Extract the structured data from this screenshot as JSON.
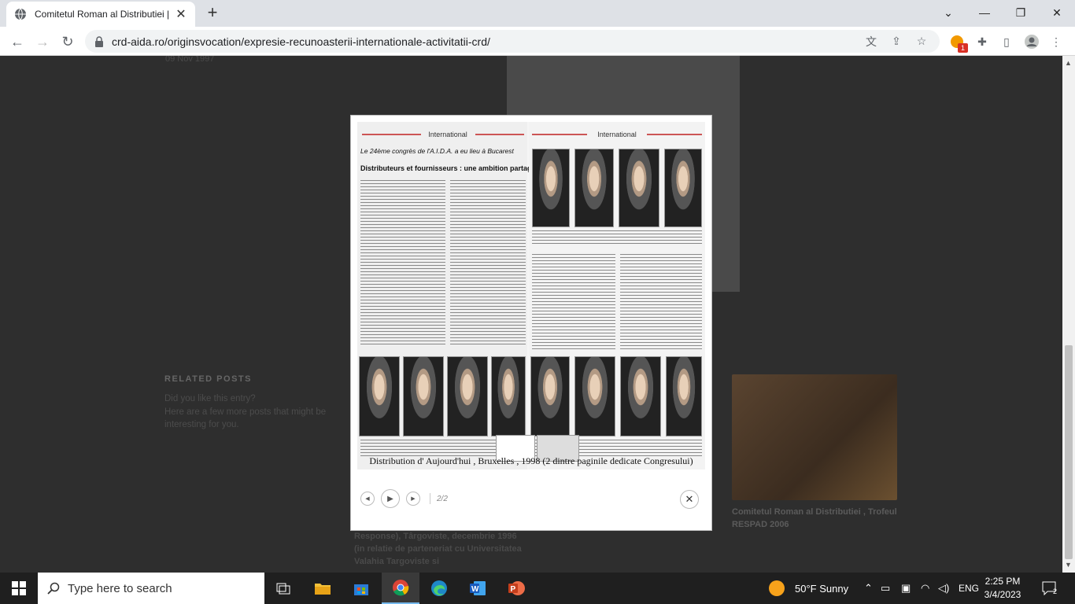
{
  "browser": {
    "tab_title": "Comitetul Roman al Distributiei |",
    "url": "crd-aida.ro/originsvocation/expresie-recunoasterii-internationale-activitatii-crd/",
    "extension_badge": "1"
  },
  "page": {
    "date_text": "09 Nov 1997",
    "related_title": "RELATED POSTS",
    "related_desc": "Did you like this entry?\nHere are a few more posts that might be interesting for you.",
    "thumb_caption": "Comitetul Roman al Distributiei , Trofeul RESPAD 2006",
    "bottom_text": "Response), Târgoviste, decembrie 1996 (in relatie de parteneriat cu Universitatea Valahia Targoviste si"
  },
  "lightbox": {
    "newspaper_header_left": "International",
    "newspaper_header_right": "International",
    "headline_small": "Le 24ème congrès de l'A.I.D.A. a eu lieu à Bucarest",
    "headline_main": "Distributeurs et fournisseurs : une ambition partagée",
    "caption": "Distribution  d' Aujourd'hui , Bruxelles , 1998 (2 dintre paginile dedicate Congresului)",
    "counter": "2/2",
    "prev_icon": "◀",
    "play_icon": "▶",
    "next_icon": "▶",
    "close_icon": "✕"
  },
  "taskbar": {
    "search_placeholder": "Type here to search",
    "weather": "50°F  Sunny",
    "language": "ENG",
    "time": "2:25 PM",
    "date": "3/4/2023",
    "notification_count": "2"
  }
}
